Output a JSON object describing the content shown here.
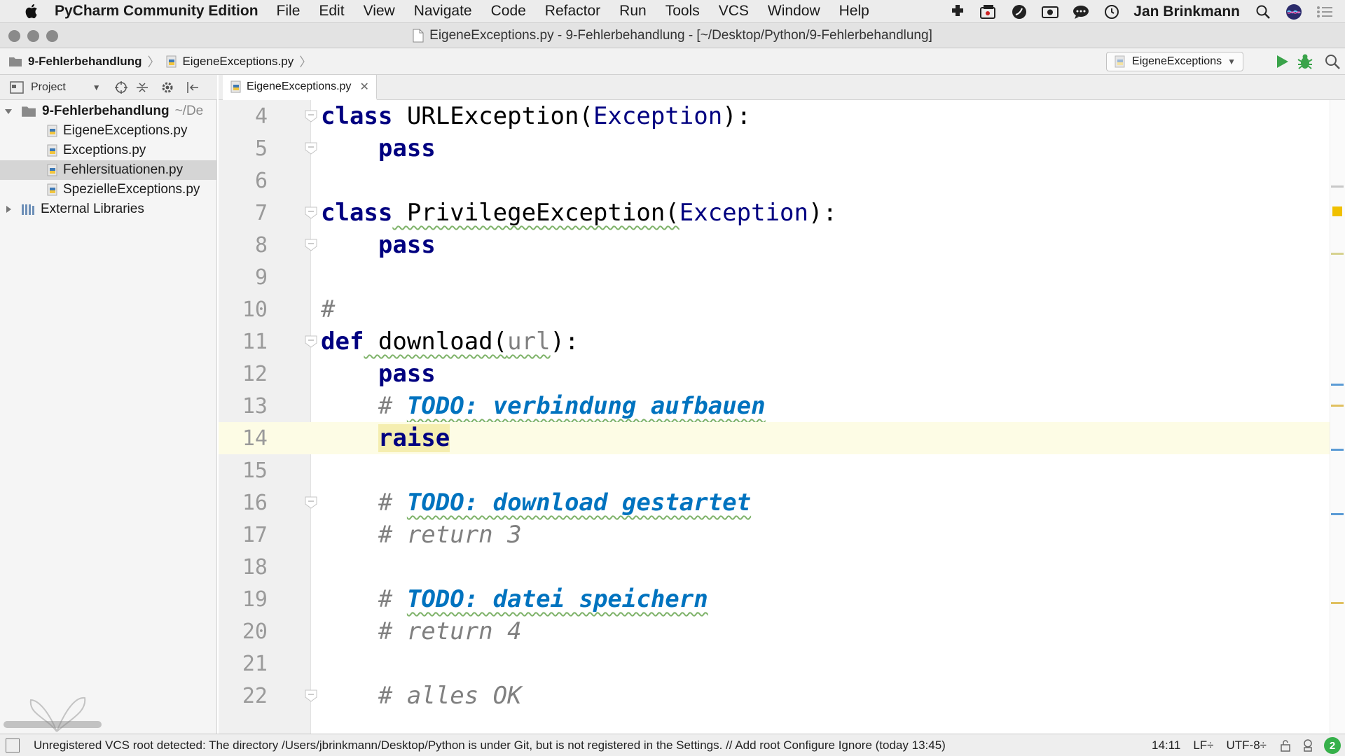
{
  "menubar": {
    "app_name": "PyCharm Community Edition",
    "items": [
      "File",
      "Edit",
      "View",
      "Navigate",
      "Code",
      "Refactor",
      "Run",
      "Tools",
      "VCS",
      "Window",
      "Help"
    ],
    "user": "Jan Brinkmann",
    "tray_icons": [
      "plugin-icon",
      "screen-record-icon",
      "leaf-icon",
      "camera-icon",
      "chat-icon",
      "time-machine-icon"
    ]
  },
  "titlebar": {
    "title": "EigeneExceptions.py - 9-Fehlerbehandlung - [~/Desktop/Python/9-Fehlerbehandlung]"
  },
  "navbar": {
    "crumbs": [
      "9-Fehlerbehandlung",
      "EigeneExceptions.py"
    ],
    "run_config": "EigeneExceptions"
  },
  "project": {
    "header_label": "Project",
    "root": "9-Fehlerbehandlung",
    "root_path": "~/De",
    "files": [
      "EigeneExceptions.py",
      "Exceptions.py",
      "Fehlersituationen.py",
      "SpezielleExceptions.py"
    ],
    "selected_file": "Fehlersituationen.py",
    "external": "External Libraries"
  },
  "editor": {
    "tab_label": "EigeneExceptions.py",
    "current_line": "14",
    "lines": [
      {
        "n": "4",
        "kw": "class",
        "name": " URLException(",
        "base": "Exception",
        "end": "):"
      },
      {
        "n": "5",
        "indent": "    ",
        "kw": "pass"
      },
      {
        "n": "6"
      },
      {
        "n": "7",
        "kw": "class",
        "name": " PrivilegeException(",
        "base": "Exception",
        "end": "):"
      },
      {
        "n": "8",
        "indent": "    ",
        "kw": "pass"
      },
      {
        "n": "9"
      },
      {
        "n": "10",
        "comment": "#"
      },
      {
        "n": "11",
        "kw": "def",
        "name": " download(",
        "param": "url",
        "end": "):"
      },
      {
        "n": "12",
        "indent": "    ",
        "kw": "pass"
      },
      {
        "n": "13",
        "indent": "    ",
        "comment": "# ",
        "todo": "TODO: verbindung aufbauen"
      },
      {
        "n": "14",
        "indent": "    ",
        "kw": "raise"
      },
      {
        "n": "15"
      },
      {
        "n": "16",
        "indent": "    ",
        "comment": "# ",
        "todo": "TODO: download gestartet"
      },
      {
        "n": "17",
        "indent": "    ",
        "comment": "# return 3"
      },
      {
        "n": "18"
      },
      {
        "n": "19",
        "indent": "    ",
        "comment": "# ",
        "todo": "TODO: datei speichern"
      },
      {
        "n": "20",
        "indent": "    ",
        "comment": "# return 4"
      },
      {
        "n": "21"
      },
      {
        "n": "22",
        "indent": "    ",
        "comment": "# alles OK"
      }
    ]
  },
  "statusbar": {
    "message": "Unregistered VCS root detected: The directory /Users/jbrinkmann/Desktop/Python is under Git, but is not registered in the Settings. // Add root  Configure  Ignore (today 13:45)",
    "position": "14:11",
    "line_sep": "LF÷",
    "encoding": "UTF-8÷",
    "notifications": "2"
  },
  "colors": {
    "keyword": "#000080",
    "todo": "#0073bf",
    "comment": "#808080",
    "current_line": "#fdfce5",
    "run_green": "#3aa34a"
  }
}
